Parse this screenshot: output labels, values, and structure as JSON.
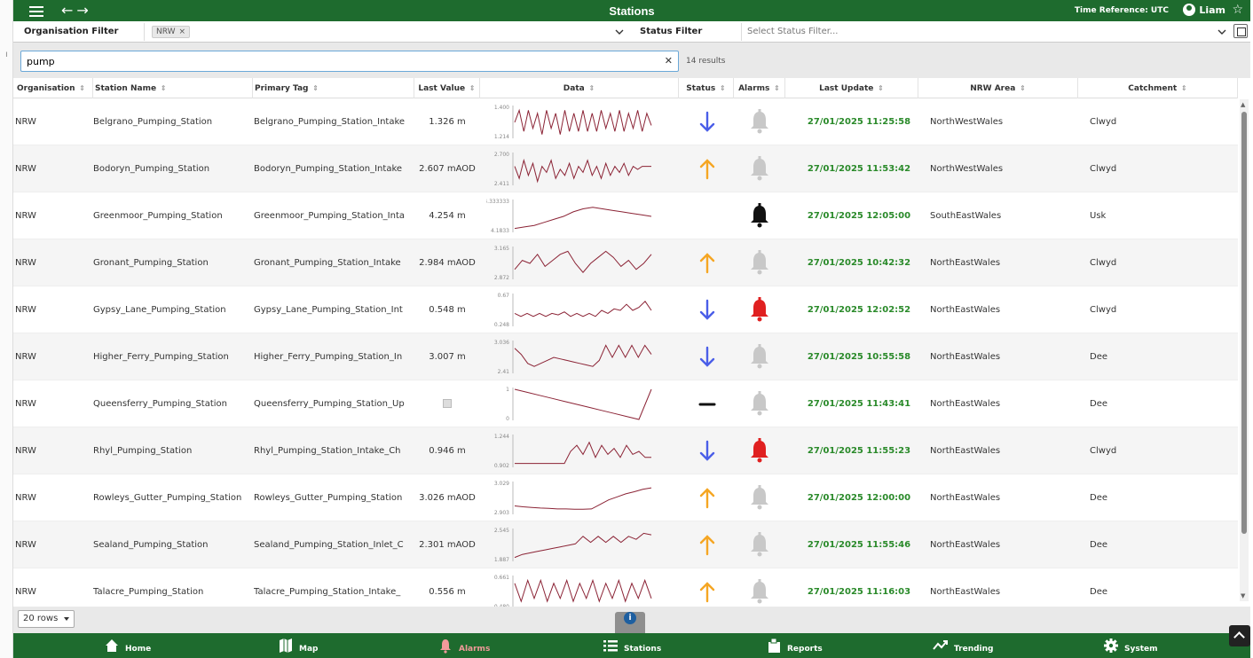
{
  "header": {
    "title": "Stations",
    "time_reference": "Time Reference: UTC",
    "user": "Liam"
  },
  "filters": {
    "organisation_label": "Organisation Filter",
    "organisation_chip": "NRW",
    "status_label": "Status Filter",
    "status_placeholder": "Select Status Filter..."
  },
  "search": {
    "value": "pump",
    "results": "14 results"
  },
  "columns": [
    "Organisation",
    "Station Name",
    "Primary Tag",
    "Last Value",
    "Data",
    "Status",
    "Alarms",
    "Last Update",
    "NRW Area",
    "Catchment"
  ],
  "rows": [
    {
      "org": "NRW",
      "station": "Belgrano_Pumping_Station",
      "tag": "Belgrano_Pumping_Station_Intake",
      "value": "1.326 m",
      "spark_max": "1.400",
      "spark_min": "1.214",
      "status": "down",
      "alarm": "inactive",
      "update": "27/01/2025 11:25:58",
      "area": "NorthWestWales",
      "catchment": "Clwyd",
      "series": [
        0.5,
        0.9,
        0.2,
        0.9,
        0.3,
        0.8,
        0.1,
        0.9,
        0.3,
        0.8,
        0.1,
        0.9,
        0.2,
        0.8,
        0.2,
        0.9,
        0.2,
        0.8,
        0.2,
        0.9,
        0.3,
        0.8,
        0.2,
        0.9,
        0.2,
        0.8,
        0.3,
        0.9,
        0.2,
        0.8,
        0.4
      ]
    },
    {
      "org": "NRW",
      "station": "Bodoryn_Pumping_Station",
      "tag": "Bodoryn_Pumping_Station_Intake",
      "value": "2.607 mAOD",
      "spark_max": "2.700",
      "spark_min": "2.411",
      "status": "up",
      "alarm": "inactive",
      "update": "27/01/2025 11:53:42",
      "area": "NorthWestWales",
      "catchment": "Clwyd",
      "series": [
        0.6,
        0.2,
        0.8,
        0.3,
        0.7,
        0.1,
        0.6,
        0.4,
        0.8,
        0.2,
        0.5,
        0.3,
        0.7,
        0.2,
        0.6,
        0.4,
        0.8,
        0.3,
        0.6,
        0.2,
        0.7,
        0.3,
        0.6,
        0.4,
        0.7,
        0.3,
        0.6,
        0.5,
        0.6,
        0.6,
        0.6
      ]
    },
    {
      "org": "NRW",
      "station": "Greenmoor_Pumping_Station",
      "tag": "Greenmoor_Pumping_Station_Inta",
      "value": "4.254 m",
      "spark_max": "4.333333",
      "spark_min": "4.1833",
      "status": "none",
      "alarm": "black",
      "update": "27/01/2025 12:05:00",
      "area": "SouthEastWales",
      "catchment": "Usk",
      "series": [
        0.1,
        0.15,
        0.2,
        0.3,
        0.4,
        0.5,
        0.65,
        0.75,
        0.8,
        0.75,
        0.7,
        0.65,
        0.6,
        0.55,
        0.5
      ]
    },
    {
      "org": "NRW",
      "station": "Gronant_Pumping_Station",
      "tag": "Gronant_Pumping_Station_Intake",
      "value": "2.984 mAOD",
      "spark_max": "3.165",
      "spark_min": "2.872",
      "status": "up",
      "alarm": "inactive",
      "update": "27/01/2025 10:42:32",
      "area": "NorthEastWales",
      "catchment": "Clwyd",
      "series": [
        0.3,
        0.6,
        0.5,
        0.8,
        0.4,
        0.6,
        0.8,
        0.9,
        0.5,
        0.2,
        0.5,
        0.7,
        0.9,
        0.7,
        0.4,
        0.6,
        0.3,
        0.5,
        0.8
      ]
    },
    {
      "org": "NRW",
      "station": "Gypsy_Lane_Pumping_Station",
      "tag": "Gypsy_Lane_Pumping_Station_Int",
      "value": "0.548 m",
      "spark_max": "0.67",
      "spark_min": "0.248",
      "status": "down",
      "alarm": "red",
      "update": "27/01/2025 12:02:52",
      "area": "NorthEastWales",
      "catchment": "Clwyd",
      "series": [
        0.4,
        0.3,
        0.4,
        0.3,
        0.4,
        0.3,
        0.4,
        0.35,
        0.45,
        0.3,
        0.4,
        0.3,
        0.4,
        0.3,
        0.5,
        0.4,
        0.55,
        0.5,
        0.7,
        0.5,
        0.6,
        0.8,
        0.5
      ]
    },
    {
      "org": "NRW",
      "station": "Higher_Ferry_Pumping_Station",
      "tag": "Higher_Ferry_Pumping_Station_In",
      "value": "3.007 m",
      "spark_max": "3.036",
      "spark_min": "2.41",
      "status": "down",
      "alarm": "inactive",
      "update": "27/01/2025 10:55:58",
      "area": "NorthEastWales",
      "catchment": "Dee",
      "series": [
        0.8,
        0.6,
        0.3,
        0.2,
        0.3,
        0.4,
        0.5,
        0.45,
        0.4,
        0.35,
        0.3,
        0.25,
        0.2,
        0.4,
        0.9,
        0.5,
        0.9,
        0.5,
        0.9,
        0.5,
        0.9,
        0.6
      ]
    },
    {
      "org": "NRW",
      "station": "Queensferry_Pumping_Station",
      "tag": "Queensferry_Pumping_Station_Up",
      "value": "",
      "spark_max": "1",
      "spark_min": "0",
      "status": "flat",
      "alarm": "inactive",
      "update": "27/01/2025 11:43:41",
      "area": "NorthEastWales",
      "catchment": "Dee",
      "series": [
        1.0,
        0.9,
        0.8,
        0.7,
        0.6,
        0.5,
        0.4,
        0.3,
        0.2,
        0.1,
        0.0,
        1.0
      ]
    },
    {
      "org": "NRW",
      "station": "Rhyl_Pumping_Station",
      "tag": "Rhyl_Pumping_Station_Intake_Ch",
      "value": "0.946 m",
      "spark_max": "1.244",
      "spark_min": "0.902",
      "status": "down",
      "alarm": "red",
      "update": "27/01/2025 11:55:23",
      "area": "NorthEastWales",
      "catchment": "Clwyd",
      "series": [
        0.1,
        0.1,
        0.1,
        0.1,
        0.1,
        0.1,
        0.1,
        0.1,
        0.1,
        0.5,
        0.7,
        0.4,
        0.8,
        0.3,
        0.7,
        0.4,
        0.6,
        0.3,
        0.7,
        0.4,
        0.5,
        0.3,
        0.3
      ]
    },
    {
      "org": "NRW",
      "station": "Rowleys_Gutter_Pumping_Station",
      "tag": "Rowleys_Gutter_Pumping_Station",
      "value": "3.026 mAOD",
      "spark_max": "3.029",
      "spark_min": "2.903",
      "status": "up",
      "alarm": "inactive",
      "update": "27/01/2025 12:00:00",
      "area": "NorthEastWales",
      "catchment": "Dee",
      "series": [
        0.25,
        0.22,
        0.2,
        0.18,
        0.17,
        0.15,
        0.15,
        0.14,
        0.14,
        0.15,
        0.3,
        0.45,
        0.55,
        0.65,
        0.72,
        0.8,
        0.85
      ]
    },
    {
      "org": "NRW",
      "station": "Sealand_Pumping_Station",
      "tag": "Sealand_Pumping_Station_Inlet_C",
      "value": "2.301 mAOD",
      "spark_max": "2.545",
      "spark_min": "1.887",
      "status": "up",
      "alarm": "inactive",
      "update": "27/01/2025 11:55:46",
      "area": "NorthEastWales",
      "catchment": "Dee",
      "series": [
        0.1,
        0.2,
        0.25,
        0.3,
        0.35,
        0.4,
        0.45,
        0.5,
        0.55,
        0.8,
        0.6,
        0.8,
        0.6,
        0.8,
        0.6,
        0.8,
        0.7,
        0.9,
        0.85
      ]
    },
    {
      "org": "NRW",
      "station": "Talacre_Pumping_Station",
      "tag": "Talacre_Pumping_Station_Intake_",
      "value": "0.556 m",
      "spark_max": "0.661",
      "spark_min": "0.480",
      "status": "up",
      "alarm": "inactive",
      "update": "27/01/2025 11:16:03",
      "area": "NorthEastWales",
      "catchment": "Dee",
      "series": [
        0.8,
        0.2,
        0.9,
        0.3,
        0.9,
        0.2,
        0.8,
        0.3,
        0.9,
        0.2,
        0.8,
        0.3,
        0.9,
        0.2,
        0.8,
        0.3,
        0.9,
        0.2,
        0.8,
        0.3,
        0.9,
        0.3
      ]
    }
  ],
  "pager": {
    "rows_per_page": "20 rows",
    "info_badge": "i"
  },
  "nav": [
    {
      "label": "Home",
      "icon": "home-icon"
    },
    {
      "label": "Map",
      "icon": "map-icon"
    },
    {
      "label": "Alarms",
      "icon": "bell-icon"
    },
    {
      "label": "Stations",
      "icon": "list-icon"
    },
    {
      "label": "Reports",
      "icon": "report-icon"
    },
    {
      "label": "Trending",
      "icon": "trend-icon"
    },
    {
      "label": "System",
      "icon": "gear-icon"
    }
  ],
  "colors": {
    "brand_green": "#1e6b2e",
    "update_green": "#2a8a2a",
    "arrow_up": "#f5a623",
    "arrow_down": "#4a5ee8",
    "alarm_red": "#e02020",
    "alarm_inactive": "#c8c8c8",
    "sparkline": "#8b2335"
  }
}
